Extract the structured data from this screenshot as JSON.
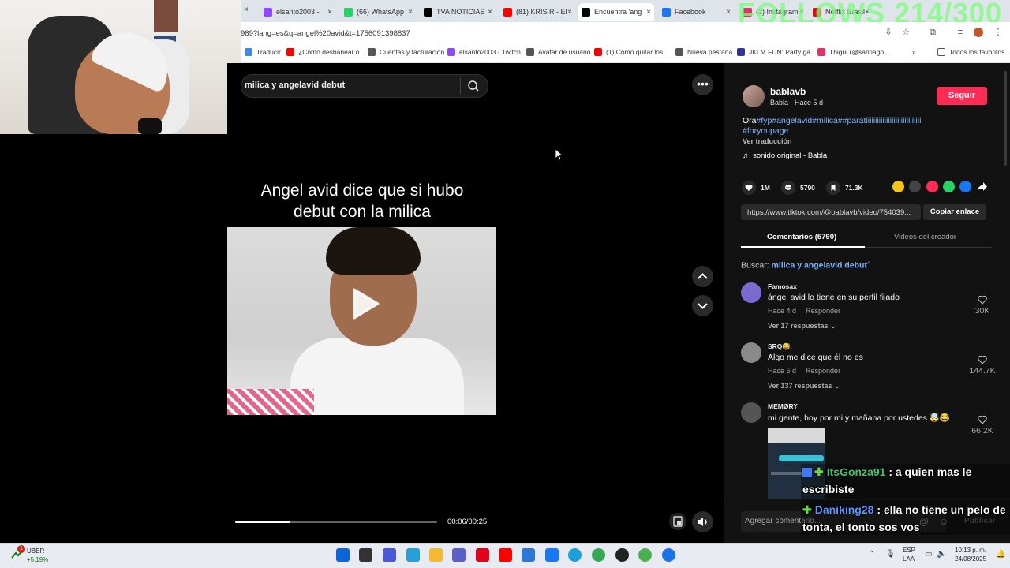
{
  "browser": {
    "tabs": [
      {
        "label": "elsanto2003 -",
        "icon_color": "#9146ff",
        "icon": "twitch-icon"
      },
      {
        "label": "(66) WhatsApp",
        "icon_color": "#25d366",
        "icon": "whatsapp-icon"
      },
      {
        "label": "TVA NOTICIAS",
        "icon_color": "#000000",
        "icon": "x-icon"
      },
      {
        "label": "(81) KRIS R - El",
        "icon_color": "#ff0000",
        "icon": "youtube-icon"
      },
      {
        "label": "Encuentra 'ang",
        "icon_color": "#000000",
        "icon": "tiktok-icon"
      },
      {
        "label": "Facebook",
        "icon_color": "#1877f2",
        "icon": "facebook-icon"
      },
      {
        "label": "(2) Instagram",
        "icon_color": "#e1306c",
        "icon": "instagram-icon"
      },
      {
        "label": "Netflix Brasil",
        "icon_color": "#e50914",
        "icon": "netflix-icon"
      }
    ],
    "close_glyph": "×",
    "url": "989?lang=es&q=angel%20avid&t=1756091398837",
    "bookmarks": [
      {
        "label": "Traducir",
        "color": "#4285f4"
      },
      {
        "label": "¿Cómo desbanear o...",
        "color": "#ff0000"
      },
      {
        "label": "Cuentas y facturación",
        "color": "#555555"
      },
      {
        "label": "elsanto2003 - Twitch",
        "color": "#9146ff"
      },
      {
        "label": "Avatar de usuario",
        "color": "#555555"
      },
      {
        "label": "(1) Como quitar los...",
        "color": "#ff0000"
      },
      {
        "label": "Nueva pestaña",
        "color": "#555555"
      },
      {
        "label": "JKLM.FUN: Party ga...",
        "color": "#333399"
      },
      {
        "label": "Thigui (@santiago...",
        "color": "#e1306c"
      }
    ],
    "bookmarks_more": "»",
    "all_favorites": "Todos los favoritos"
  },
  "overlay": {
    "follows": "FOLLOWS 214/300"
  },
  "search": {
    "query": "milica y angelavid debut"
  },
  "video": {
    "caption_line1": "Angel avid dice que si hubo",
    "caption_line2": "debut con la milica",
    "time": "00:06/00:25",
    "progress": 0.273
  },
  "creator": {
    "name": "bablavb",
    "sub": "Babla · Hace 5 d",
    "follow_label": "Seguir",
    "desc_prefix": "Ora",
    "desc_tags_1": "#fyp#angelavid#milica##parati",
    "desc_tags_1b": "iiiiiiiiiiiiiiiiiiiiiiiiiiiii",
    "desc_tags_2": "#foryoupage",
    "see_translation": "Ver traducción",
    "music": "sonido original - Babla"
  },
  "stats": {
    "likes": "1M",
    "comments": "5790",
    "saves": "71.3K"
  },
  "share": {
    "link": "https://www.tiktok.com/@bablavb/video/754039...",
    "copy_label": "Copiar enlace",
    "colors": [
      "#f5c518",
      "#444444",
      "#fe2c55",
      "#25d366",
      "#1877f2"
    ]
  },
  "tabs": {
    "comments": "Comentarios (5790)",
    "creator_videos": "Videos del creador"
  },
  "related": {
    "prefix": "Buscar:",
    "query": "milica y angelavid debut"
  },
  "comments": [
    {
      "user": "Famosax",
      "text": "ángel avid lo tiene en su perfil fijado",
      "time": "Hace 4 d",
      "reply": "Responder",
      "replies": "Ver 17 respuestas ⌄",
      "likes": "30K",
      "avatar_color": "#7a6bd1"
    },
    {
      "user": "SRQ😅",
      "text": "Algo me dice que él no es",
      "time": "Hace 5 d",
      "reply": "Responder",
      "replies": "Ver 137 respuestas ⌄",
      "likes": "144.7K",
      "avatar_color": "#8a8a8a"
    },
    {
      "user": "MEMØRY",
      "text": "mi gente, hoy por mi y mañana por ustedes 🤯😂",
      "likes": "66.2K",
      "avatar_color": "#555555"
    }
  ],
  "add_comment": {
    "placeholder": "Agregar comentario...",
    "publish": "Publicar"
  },
  "chat": [
    {
      "name": "ItsGonza91",
      "message_1": ": a quien mas le",
      "message_2": "escribiste"
    },
    {
      "name": "Daniking28",
      "message_1": ": ella no tiene un pelo de",
      "message_2": "tonta, el tonto sos vos"
    }
  ],
  "taskbar": {
    "stock_name": "UBER",
    "stock_change": "+5,19%",
    "stock_badge": "1",
    "lang_1": "ESP",
    "lang_2": "LAA",
    "time": "10:13 p. m.",
    "date": "24/08/2025",
    "apps": [
      {
        "name": "windows-start-icon",
        "color": "#0a66d6"
      },
      {
        "name": "task-view-icon",
        "color": "#333333"
      },
      {
        "name": "meet-icon",
        "color": "#4b56d8"
      },
      {
        "name": "copilot-icon",
        "color": "#26a0d8"
      },
      {
        "name": "file-explorer-icon",
        "color": "#f2b931"
      },
      {
        "name": "teams-icon",
        "color": "#5b5fc7"
      },
      {
        "name": "opera-icon",
        "color": "#e3001b"
      },
      {
        "name": "youtube-app-icon",
        "color": "#ff0000"
      },
      {
        "name": "store-icon",
        "color": "#2b78d6"
      },
      {
        "name": "facebook-app-icon",
        "color": "#1877f2"
      },
      {
        "name": "edge-icon",
        "color": "#1d9fd9"
      },
      {
        "name": "chrome-icon",
        "color": "#34a853"
      },
      {
        "name": "obs-icon",
        "color": "#222222"
      },
      {
        "name": "chrome-profile-icon",
        "color": "#4caf50"
      },
      {
        "name": "chrome-alt-icon",
        "color": "#1a73e8"
      }
    ]
  }
}
